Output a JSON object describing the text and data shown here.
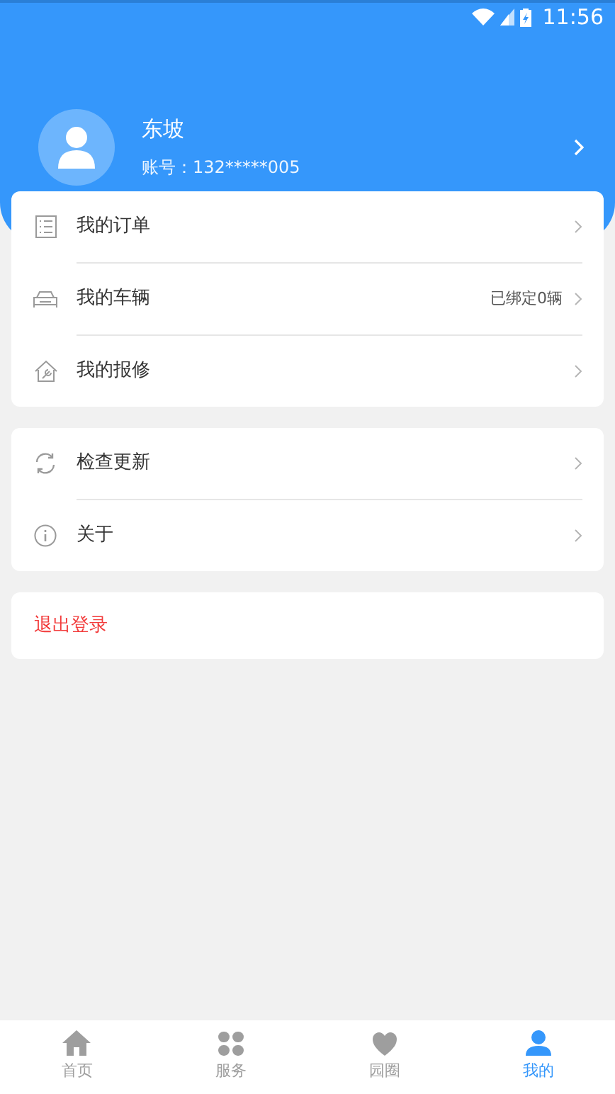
{
  "status_bar": {
    "time": "11:56"
  },
  "profile": {
    "name": "东坡",
    "account": "账号：132*****005"
  },
  "menu_groups": [
    {
      "items": [
        {
          "kind": "orders",
          "label": "我的订单"
        },
        {
          "kind": "vehicle",
          "label": "我的车辆",
          "detail": "已绑定0辆"
        },
        {
          "kind": "repair",
          "label": "我的报修"
        }
      ]
    },
    {
      "items": [
        {
          "kind": "update",
          "label": "检查更新"
        },
        {
          "kind": "about",
          "label": "关于"
        }
      ]
    }
  ],
  "logout": {
    "label": "退出登录"
  },
  "tab_bar": [
    {
      "kind": "home",
      "label": "首页",
      "selected": false
    },
    {
      "kind": "services",
      "label": "服务",
      "selected": false
    },
    {
      "kind": "community",
      "label": "园圈",
      "selected": false
    },
    {
      "kind": "mine",
      "label": "我的",
      "selected": true
    }
  ]
}
